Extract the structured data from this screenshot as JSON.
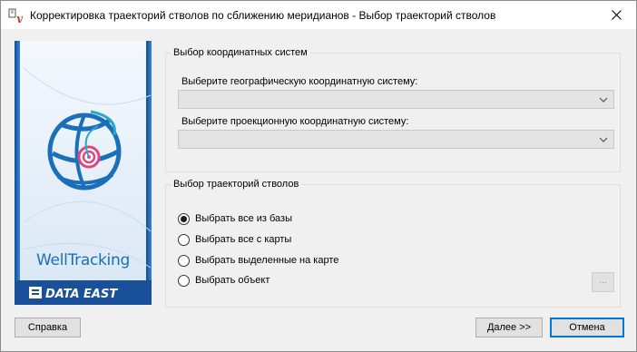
{
  "window": {
    "title": "Корректировка траекторий стволов по сближению меридианов - Выбор траекторий стволов",
    "app_icon": "wellpath-app-icon",
    "close_icon": "close-icon"
  },
  "banner": {
    "brand": "WellTracking",
    "vendor_logo": "DATA EAST"
  },
  "coord_group": {
    "title": "Выбор координатных систем",
    "geo_label": "Выберите географическую координатную систему:",
    "geo_value": "",
    "proj_label": "Выберите проекционную координатную систему:",
    "proj_value": ""
  },
  "traj_group": {
    "title": "Выбор траекторий стволов",
    "options": [
      {
        "label": "Выбрать все из базы",
        "checked": true
      },
      {
        "label": "Выбрать все с карты",
        "checked": false
      },
      {
        "label": "Выбрать выделенные на карте",
        "checked": false
      },
      {
        "label": "Выбрать объект",
        "checked": false
      }
    ],
    "browse_label": "..."
  },
  "buttons": {
    "help": "Справка",
    "next": "Далее >>",
    "cancel": "Отмена"
  },
  "colors": {
    "accent": "#0078d7",
    "brand_blue": "#1a6fb8",
    "brand_pink": "#e0457b",
    "footer_blue": "#1a4f9a"
  }
}
